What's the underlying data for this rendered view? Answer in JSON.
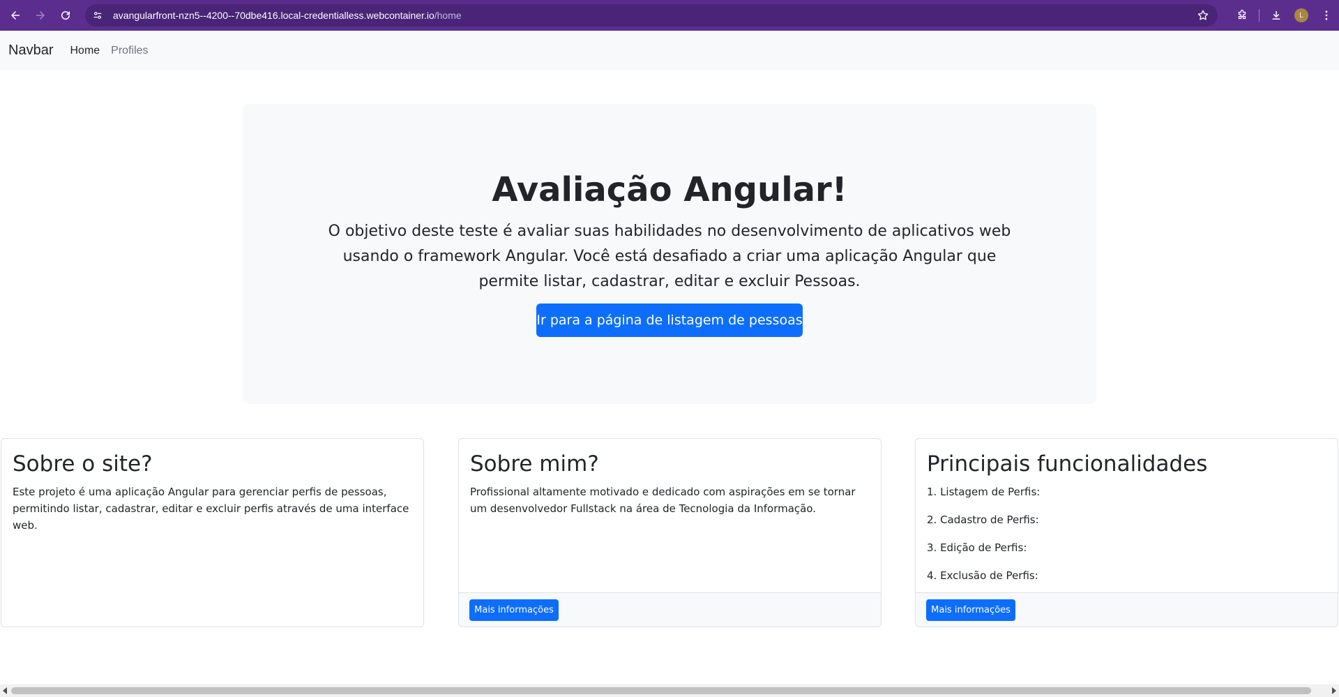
{
  "browser": {
    "url_host": "avangularfront-nzn5--4200--70dbe416.local-credentialless.webcontainer.io",
    "url_path": "/home",
    "avatar_initial": "L",
    "theme_color": "#5b2e8e"
  },
  "navbar": {
    "brand": "Navbar",
    "links": [
      {
        "label": "Home",
        "active": true
      },
      {
        "label": "Profiles",
        "active": false
      }
    ]
  },
  "hero": {
    "title": "Avaliação Angular!",
    "description": "O objetivo deste teste é avaliar suas habilidades no desenvolvimento de aplicativos web usando o framework Angular. Você está desafiado a criar uma aplicação Angular que permite listar, cadastrar, editar e excluir Pessoas.",
    "button_label": "Ir para a página de listagem de pessoas"
  },
  "cards": [
    {
      "title": "Sobre o site?",
      "text": "Este projeto é uma aplicação Angular para gerenciar perfis de pessoas, permitindo listar, cadastrar, editar e excluir perfis através de uma interface web."
    },
    {
      "title": "Sobre mim?",
      "text": "Profissional altamente motivado e dedicado com aspirações em se tornar um desenvolvedor Fullstack na área de Tecnologia da Informação.",
      "button_label": "Mais informações"
    },
    {
      "title": "Principais funcionalidades",
      "items": [
        "1. Listagem de Perfis:",
        "2. Cadastro de Perfis:",
        "3. Edição de Perfis:",
        "4. Exclusão de Perfis:"
      ],
      "button_label": "Mais informações"
    }
  ],
  "colors": {
    "primary": "#0d6efd",
    "light_bg": "#f8f9fa",
    "text": "#212529",
    "muted": "#6c757d"
  },
  "icons": [
    "back-arrow-icon",
    "forward-arrow-icon",
    "reload-icon",
    "site-settings-icon",
    "bookmark-star-icon",
    "extensions-icon",
    "download-icon",
    "menu-kebab-icon"
  ]
}
